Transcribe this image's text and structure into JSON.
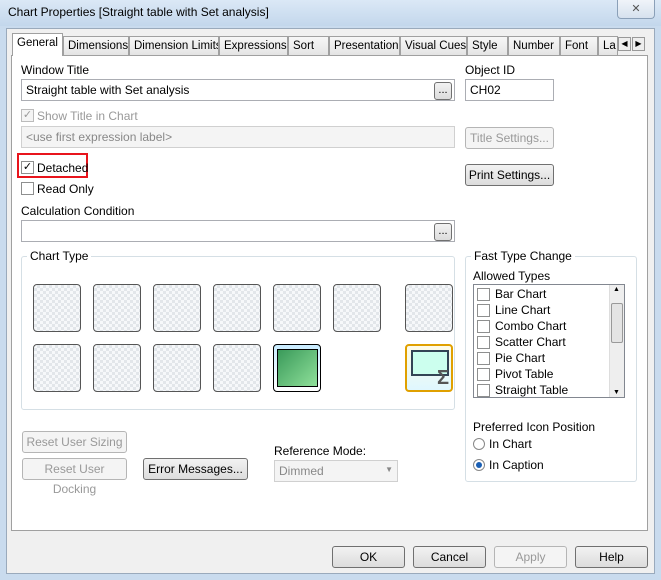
{
  "window": {
    "title": "Chart Properties [Straight table with Set analysis]",
    "close_icon": "close-x-icon"
  },
  "tabs": [
    "General",
    "Dimensions",
    "Dimension Limits",
    "Expressions",
    "Sort",
    "Presentation",
    "Visual Cues",
    "Style",
    "Number",
    "Font",
    "La"
  ],
  "general": {
    "window_title_label": "Window Title",
    "window_title_value": "Straight table with Set analysis",
    "object_id_label": "Object ID",
    "object_id_value": "CH02",
    "show_title_label": "Show Title in Chart",
    "show_title_checked": true,
    "title_placeholder": "<use first expression label>",
    "title_settings": "Title Settings...",
    "print_settings": "Print Settings...",
    "detached_label": "Detached",
    "detached_checked": true,
    "highlight_color": "#e8141c",
    "read_only_label": "Read Only",
    "read_only_checked": false,
    "calc_condition_label": "Calculation Condition",
    "calc_condition_value": "",
    "browse": "...",
    "chart_type_label": "Chart Type",
    "chart_types_row1": [
      "bar-chart",
      "line-chart",
      "combo-chart",
      "radar-chart",
      "gauge-chart",
      "mekko-chart",
      "pivot-table"
    ],
    "chart_types_row2": [
      "scatter-chart",
      "grid-chart",
      "pie-chart",
      "funnel-chart",
      "block-chart",
      "straight-table"
    ],
    "selected_chart_type": "straight-table",
    "fast_type_change_label": "Fast Type Change",
    "allowed_types_label": "Allowed Types",
    "allowed_types": [
      "Bar Chart",
      "Line Chart",
      "Combo Chart",
      "Scatter Chart",
      "Pie Chart",
      "Pivot Table",
      "Straight Table"
    ],
    "preferred_icon_position_label": "Preferred Icon Position",
    "icon_positions": [
      "In Chart",
      "In Caption"
    ],
    "selected_icon_position": "In Caption",
    "reset_user_sizing": "Reset User Sizing",
    "reset_user_docking": "Reset User Docking",
    "error_messages": "Error Messages...",
    "reference_mode_label": "Reference Mode:",
    "reference_mode_value": "Dimmed"
  },
  "footer": {
    "ok": "OK",
    "cancel": "Cancel",
    "apply": "Apply",
    "help": "Help"
  }
}
